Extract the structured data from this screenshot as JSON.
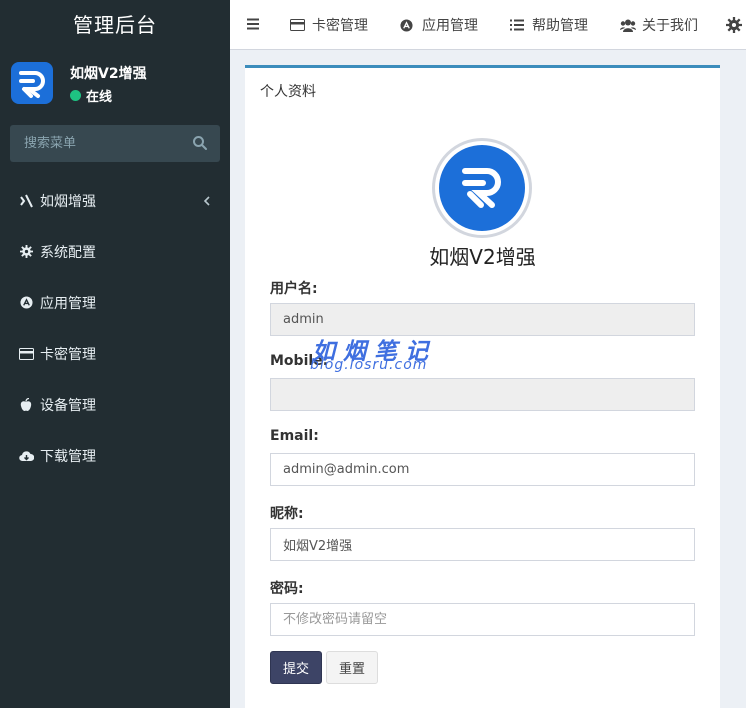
{
  "sidebar": {
    "brand": "管理后台",
    "user": {
      "name": "如烟V2增强",
      "status": "在线"
    },
    "search_placeholder": "搜索菜单",
    "items": [
      {
        "label": "如烟增强",
        "icon": "xing-icon"
      },
      {
        "label": "系统配置",
        "icon": "gear-icon"
      },
      {
        "label": "应用管理",
        "icon": "app-store-icon"
      },
      {
        "label": "卡密管理",
        "icon": "credit-card-icon"
      },
      {
        "label": "设备管理",
        "icon": "apple-icon"
      },
      {
        "label": "下载管理",
        "icon": "cloud-download-icon"
      }
    ]
  },
  "topbar": {
    "items": [
      {
        "label": "卡密管理",
        "icon": "credit-card-icon"
      },
      {
        "label": "应用管理",
        "icon": "app-store-icon"
      },
      {
        "label": "帮助管理",
        "icon": "list-icon"
      },
      {
        "label": "关于我们",
        "icon": "users-icon"
      }
    ]
  },
  "panel": {
    "title": "个人资料",
    "profile_name": "如烟V2增强",
    "form": {
      "username_label": "用户名:",
      "username_value": "admin",
      "mobile_label": "Mobile:",
      "mobile_value": "",
      "email_label": "Email:",
      "email_value": "admin@admin.com",
      "nickname_label": "昵称:",
      "nickname_value": "如烟V2增强",
      "password_label": "密码:",
      "password_placeholder": "不修改密码请留空",
      "submit_label": "提交",
      "reset_label": "重置"
    }
  },
  "watermark": {
    "line1": "如烟笔记",
    "line2": "blog.iosru.com"
  },
  "colors": {
    "sidebar_bg": "#222d32",
    "accent": "#3c8dbc",
    "logo_blue": "#1c6fd9",
    "online": "#1ec282"
  }
}
